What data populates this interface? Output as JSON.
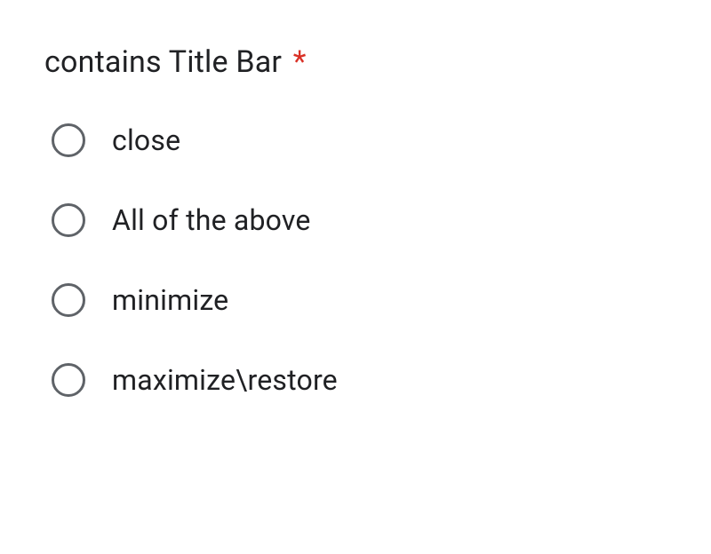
{
  "question": {
    "title": "contains Title Bar",
    "required_marker": "*",
    "options": [
      {
        "label": "close"
      },
      {
        "label": "All of the above"
      },
      {
        "label": "minimize"
      },
      {
        "label": "maximize\\restore"
      }
    ]
  }
}
